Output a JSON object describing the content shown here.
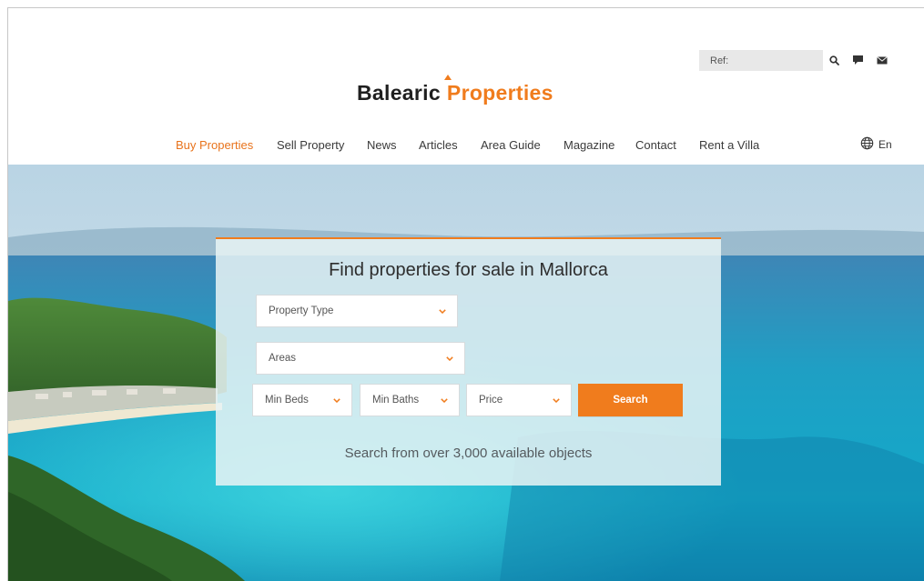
{
  "header": {
    "ref_placeholder": "Ref:",
    "logo": {
      "word_1": "Balearic",
      "word_2": "Properties"
    },
    "icons": [
      "search-icon",
      "chat-icon",
      "mail-icon"
    ]
  },
  "nav": {
    "items": [
      {
        "label": "Buy Properties",
        "active": true
      },
      {
        "label": "Sell Property"
      },
      {
        "label": "News"
      },
      {
        "label": "Articles"
      },
      {
        "label": "Area Guide"
      },
      {
        "label": "Magazine"
      },
      {
        "label": "Contact"
      },
      {
        "label": "Rent a Villa"
      }
    ],
    "language": {
      "label": "En",
      "icon": "globe-icon"
    }
  },
  "search": {
    "title": "Find properties for sale in Mallorca",
    "property_type": "Property Type",
    "areas": "Areas",
    "min_beds": "Min Beds",
    "min_baths": "Min Baths",
    "price": "Price",
    "button_label": "Search",
    "subtitle": "Search from over 3,000 available objects"
  },
  "colors": {
    "accent": "#f07c1d",
    "nav_active": "#e8731c",
    "text_dark": "#2d2d2d"
  }
}
